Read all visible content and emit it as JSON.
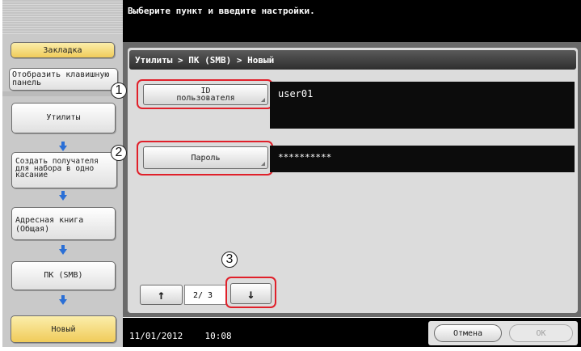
{
  "header": {
    "instruction": "Выберите пункт и введите настройки."
  },
  "sidebar": {
    "bookmark_label": "Закладка",
    "show_keypad_label": "Отобразить клавишную панель",
    "path_items": [
      {
        "label": "Утилиты"
      },
      {
        "label": "Создать получателя для набора в одно касание"
      },
      {
        "label": "Адресная книга (Общая)"
      },
      {
        "label": "ПК (SMB)"
      },
      {
        "label": "Новый"
      }
    ]
  },
  "main": {
    "breadcrumb": "Утилиты > ПК (SMB) > Новый",
    "fields": [
      {
        "button_label": "ID пользователя",
        "value": "user01",
        "callout": "1"
      },
      {
        "button_label": "Пароль",
        "value": "**********",
        "callout": "2"
      }
    ],
    "pagination": {
      "up_icon": "arrow-up-icon",
      "page_text": "2/ 3",
      "down_icon": "arrow-down-icon",
      "callout": "3"
    }
  },
  "footer": {
    "date": "11/01/2012",
    "time": "10:08",
    "cancel_label": "Отмена",
    "ok_label": "OK"
  },
  "colors": {
    "highlight_ring": "#e0202a",
    "active_button": "#f0cb5a",
    "path_arrow": "#2a6fd6"
  }
}
